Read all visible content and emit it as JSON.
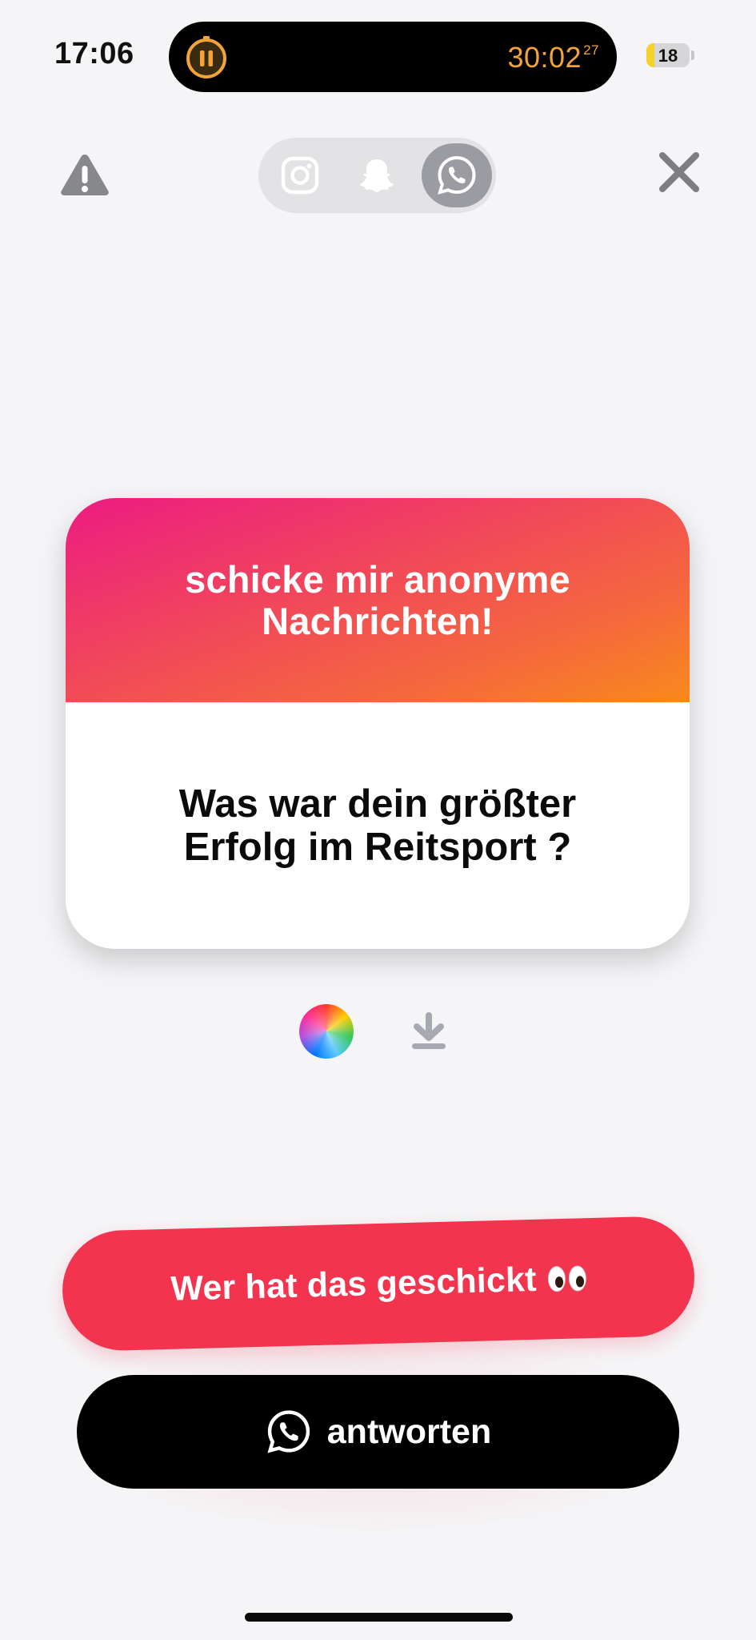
{
  "status_bar": {
    "time": "17:06",
    "timer": "30:02",
    "timer_fraction": "27",
    "battery_level": "18",
    "battery_percent": 18
  },
  "toolbar": {
    "report_icon": "warning-triangle-icon",
    "share_options": [
      {
        "name": "instagram",
        "icon": "instagram-icon",
        "selected": false
      },
      {
        "name": "snapchat",
        "icon": "snapchat-ghost-icon",
        "selected": false
      },
      {
        "name": "whatsapp",
        "icon": "whatsapp-icon",
        "selected": true
      }
    ],
    "close_icon": "close-x-icon"
  },
  "card": {
    "title": "schicke mir anonyme Nachrichten!",
    "question": "Was war dein größter Erfolg im Reitsport ?",
    "gradient_colors": [
      "#ec1c82",
      "#f14a58",
      "#f98a1c"
    ]
  },
  "tools": {
    "color_icon": "color-wheel-icon",
    "download_icon": "download-icon"
  },
  "actions": {
    "who_sent_label": "Wer hat das geschickt",
    "who_sent_emoji": "eyes-emoji",
    "reply_label": "antworten",
    "reply_icon": "whatsapp-icon"
  },
  "colors": {
    "accent_red": "#f2344e",
    "timer_orange": "#f2a33a",
    "battery_yellow": "#f4d22b"
  }
}
